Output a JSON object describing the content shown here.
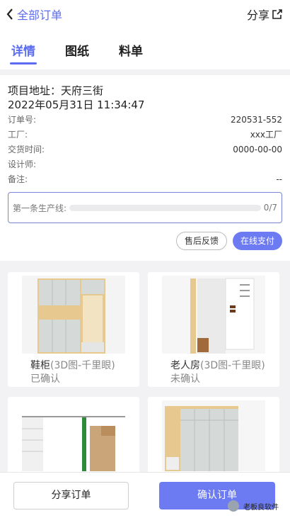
{
  "header": {
    "back_label": "全部订单",
    "share_label": "分享"
  },
  "tabs": [
    {
      "label": "详情",
      "active": true
    },
    {
      "label": "图纸",
      "active": false
    },
    {
      "label": "料单",
      "active": false
    }
  ],
  "order": {
    "address": "项目地址：天府三街",
    "datetime": "2022年05月31日 11:34:47",
    "fields": [
      {
        "label": "订单号:",
        "value": "220531-552"
      },
      {
        "label": "工厂:",
        "value": "xxx工厂"
      },
      {
        "label": "交货时间:",
        "value": "0000-00-00"
      },
      {
        "label": "设计师:",
        "value": ""
      },
      {
        "label": "备注:",
        "value": "--"
      }
    ],
    "production_label": "第一条生产线:",
    "production_progress": "0/7",
    "production_fraction": 0
  },
  "actions": {
    "after_sales": "售后反馈",
    "pay_online": "在线支付"
  },
  "designs": [
    {
      "name": "鞋柜",
      "type": "(3D图-千里眼)",
      "status": "已确认"
    },
    {
      "name": "老人房",
      "type": "(3D图-千里眼)",
      "status": "未确认"
    },
    {
      "name": "",
      "type": "",
      "status": ""
    },
    {
      "name": "",
      "type": "",
      "status": ""
    }
  ],
  "bottom": {
    "share_order": "分享订单",
    "confirm_order": "确认订单",
    "watermark": "老板良软件"
  },
  "colors": {
    "accent": "#5b6cf0",
    "button_fill": "#6d7bf2"
  }
}
